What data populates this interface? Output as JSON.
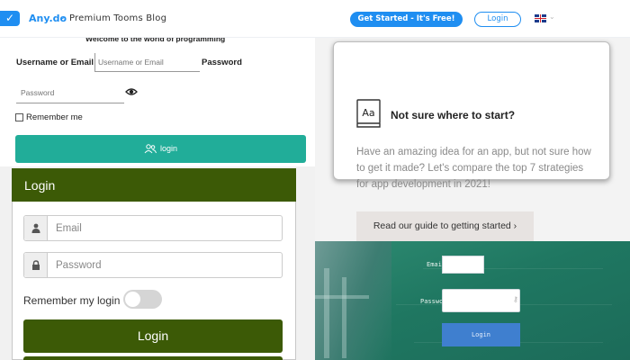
{
  "header": {
    "brand": "Any.do",
    "blog_title": "Premium Tooms Blog",
    "get_started_label": "Get Started - It's Free!",
    "login_label": "Login",
    "language_icon": "uk-flag-icon"
  },
  "form_top": {
    "welcome": "Welcome to the world of programming",
    "username_label": "Username or Email",
    "username_placeholder": "Username or Email",
    "password_label": "Password",
    "password_placeholder": "Password",
    "remember_label": "Remember me",
    "login_button": "login"
  },
  "login_card": {
    "title": "Login",
    "email_placeholder": "Email",
    "password_placeholder": "Password",
    "remember_label": "Remember my login",
    "remember_on": false,
    "login_button": "Login"
  },
  "promo": {
    "icon_text": "Aa",
    "heading": "Not sure where to start?",
    "body": "Have an amazing idea for an app, but not sure how to get it made? Let's compare the top 7 strategies for app development in 2021!",
    "guide_button": "Read our guide to getting started ›"
  },
  "chalk_form": {
    "email_label": "Email",
    "password_label": "Password",
    "login_button": "Login"
  },
  "colors": {
    "brand_blue": "#1f8ef1",
    "teal": "#21ad99",
    "olive": "#3c5a06",
    "chalk_green": "#1f7761"
  }
}
